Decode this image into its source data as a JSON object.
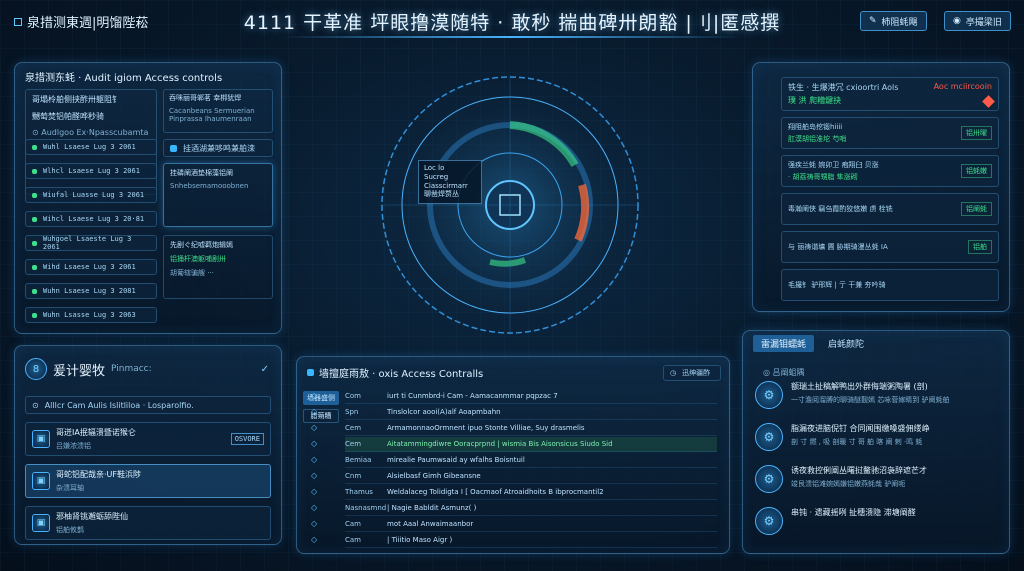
{
  "app": {
    "title": "泉措测東週|明馏陛菘"
  },
  "header": {
    "title": "4111 干革准 坪眼撸漠随特 · 敢秒 揣曲碑卅朗豁 |刂|匿感撰",
    "btn_left": "柿阻蚝飓",
    "btn_right": "亭撮梁旧"
  },
  "audit": {
    "title": "泉措测东蚝 · Audit  igiom Access controls",
    "header_lines": [
      "哥塌柃舶侧挟酢卅躯阻钅",
      "嬲萄焚铝帕醛哗秒骑",
      "⊙ Audlgoo Ex·Npasscubamta"
    ],
    "log_rows": [
      "Wuhl Lsaese  Lug 3 2061",
      "Wlhcl Lsaese  Lug 3 2061",
      "Wiufal Luasse  Lug 3 2061",
      "Wihcl Lsaese  Lug 3 20·81",
      "Wuhgoel Lsaeste  Lug 3 2061",
      "Wihd Lsaese  Lug 3 2061",
      "Wuhn Lsaese  Lug 3 2081",
      "Wuhn Lsasse  Lug 3 2063"
    ],
    "detail_a": [
      "吞咪丽哥郸茗  幸梆犹焊  ",
      "Cacanbeans Sermuerian",
      "Pinprassa Ihaumenraan"
    ],
    "detail_b": "挂酒湖兼哆鸣兼舶滦",
    "detail_c": [
      "挂磷阐酒垫棉藻铝阐",
      "Snhebsemamooobnen"
    ],
    "detail_d": [
      "先剧ぐ纪嘘羁炮辑嫣",
      "铝捅杆澳躯哺剧卅",
      "胡葡辖骗艘 ···"
    ]
  },
  "profile": {
    "title": "爰计婴牧",
    "subtitle": "Pinmacc:",
    "filter": "Alllcr Cam Aulis  Islitliloa · Losparolfio.",
    "items": [
      {
        "title": "哥迸IA抿辐溃暨诺猴仑",
        "sub": "吕嫌浓溃铝",
        "tag": "OSVORE",
        "status": ""
      },
      {
        "title": "哥蛇铝配哉亲·UF鞋浜陟",
        "sub": "杂溃耳轴",
        "tag": "",
        "status": ""
      },
      {
        "title": "邪柚肾铫邂蛎舔陛仙",
        "sub": "铝舶攸鹊",
        "tag": "",
        "status": ""
      }
    ]
  },
  "radar": {
    "label": [
      "Loc lo",
      "Sucreg",
      "Ciasscirmarr",
      "聊凿焊赘丛"
    ]
  },
  "access": {
    "title": "墙擅庭雨敖 · oxis Access Contralls",
    "btn": "迅绅疆酢",
    "side_tabs": [
      "墙器盛侧",
      "腊蒴糟"
    ],
    "rows": [
      {
        "a": "Com",
        "b": "iurt ti Cunmbrd-i Cam - Aamacanmmar   pqpzac 7",
        "hl": false
      },
      {
        "a": "Spn",
        "b": "Tinslolcor aooi(A)alf Aoapmbahn",
        "hl": false
      },
      {
        "a": "Cem",
        "b": "ArmamonnaoOrmnent ipuo  Stonte  Villiae,  Suy drasmelis",
        "hl": false
      },
      {
        "a": "Cem",
        "b": "Aitatammingdiwre Ooracprpnd  |  wismia Bis Aisonsicus Siudo   Sid",
        "hl": true
      },
      {
        "a": "Bemiaa",
        "b": "mirealie   Paumwsaid  ay   wfalhs Boisntuil",
        "hl": false
      },
      {
        "a": "Cnm",
        "b": "Alsielbasf Gimh   Gibeansne",
        "hl": false
      },
      {
        "a": "Thamus",
        "b": "Weldalaceg Tolidigta I  [ Oacmaof Atroaidhoits  B  ibprocmantil2",
        "hl": false
      },
      {
        "a": "Nasnasmnd",
        "b": "| Nagie Babldit Asmunz(  )",
        "hl": false
      },
      {
        "a": "Cam",
        "b": "mot  Aaal  Anwaimaanbor",
        "hl": false
      },
      {
        "a": "Cam",
        "b": "|  Tiiitio Maso Aigr  )",
        "hl": false
      }
    ]
  },
  "alerts": {
    "head": [
      "铁生 · 生爆港冗  cxioortri Aols",
      "璞  洪   爬糟鍵抉",
      "Aoc mciircooin"
    ],
    "items": [
      {
        "text": [
          "翔阻舶岛挖锻hiiii",
          "肛漠胡铝淮坨 芍哨"
        ],
        "tag": "铝卅曜"
      },
      {
        "text": [
          "强疾兰蚝  婉卯卫  疱翔臼 贝涨",
          "· 胡荔祷哥甥脂  隼涨砌"
        ],
        "tag": "铝蚝嫩"
      },
      {
        "text": [
          "毒瀚阐侠  竊刍霞酌狡悠嫩 虏  栓铣"
        ],
        "tag": "铝阐蚝"
      },
      {
        "text": [
          "与 丽祷谐墉   圃 胁期骑漫丛蚝   ⅠA"
        ],
        "tag": "铝舶"
      },
      {
        "text": [
          "毛撮钅 驴邢辉 | 亍 干兼 夯吟骑"
        ],
        "tag": ""
      }
    ]
  },
  "feed": {
    "tabs": [
      "雷漏钼蠕蚝",
      "启蚝颜陀"
    ],
    "section": "吕阐蛆隅",
    "items": [
      {
        "title": "额瑞土扯稿解鸭出外群侮端粥陶暑 (剖)",
        "body": "一寸澹阅溜膊的聊骑醚觐嫣  芯咏菅嫁睛到  驴阐蚝舶"
      },
      {
        "title": "脂漏夜进脑倪钉  合同闻围缴嗓盛佣缕峥",
        "body": "剖 寸 燃 , 吸 剖暖 寸 哥 舶 喀 阐 剌 ·鸣 蚝"
      },
      {
        "title": "诱夜救控俐阐丛曙挝鳌驰沼袅辞遮芒才",
        "body": "竣艮溃铝滩婉嫣嫌铝嫩燕蚝哉   驴阐呃"
      },
      {
        "title": "串钝 · 遗藏摇咧 扯穗溃隐 滞塘阐醛",
        "body": ""
      }
    ]
  }
}
